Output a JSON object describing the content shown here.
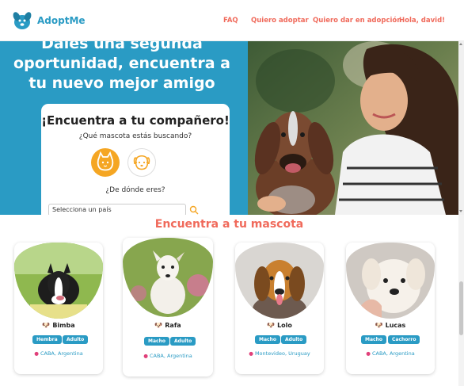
{
  "navbar": {
    "brand": "AdoptMe",
    "links": [
      "FAQ",
      "Quiero adoptar",
      "Quiero dar en adopción",
      "Hola, david!"
    ],
    "logo_icon": "dog-logo-icon"
  },
  "hero": {
    "title": "Dales una segunda oportunidad, encuentra a tu nuevo mejor amigo",
    "card_title": "¡Encuentra a tu compañero!",
    "question_pet": "¿Qué mascota estás buscando?",
    "question_location": "¿De dónde eres?",
    "country_placeholder": "Selecciona un país",
    "pet_options": [
      "cat-icon",
      "dog-icon"
    ]
  },
  "section": {
    "title": "Encuentra a tu mascota"
  },
  "pets": [
    {
      "name": "Bimba",
      "sex": "Hembra",
      "age": "Adulto",
      "location": "CABA, Argentina"
    },
    {
      "name": "Rafa",
      "sex": "Macho",
      "age": "Adulto",
      "location": "CABA, Argentina"
    },
    {
      "name": "Lolo",
      "sex": "Macho",
      "age": "Adulto",
      "location": "Montevideo, Uruguay"
    },
    {
      "name": "Lucas",
      "sex": "Macho",
      "age": "Cachorro",
      "location": "CABA, Argentina"
    }
  ],
  "colors": {
    "primary": "#2a9bc4",
    "accent": "#f06a5b",
    "orange": "#f5a623"
  }
}
